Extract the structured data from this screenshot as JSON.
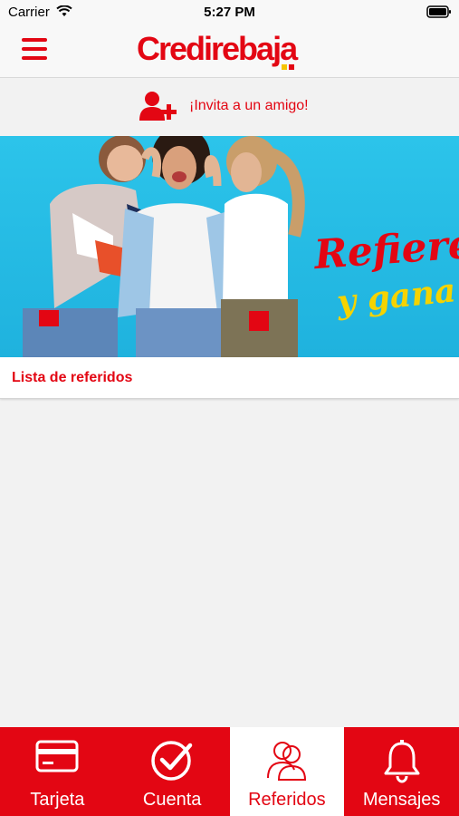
{
  "status_bar": {
    "carrier": "Carrier",
    "time": "5:27 PM"
  },
  "header": {
    "logo": "Credirebaja"
  },
  "invite": {
    "label": "¡Invita a un amigo!"
  },
  "banner": {
    "title": "Refiere",
    "subtitle": "y gana"
  },
  "list": {
    "title": "Lista de referidos"
  },
  "colors": {
    "brand_red": "#e30613",
    "accent_yellow": "#f5c400",
    "banner_blue": "#2cc4ea"
  },
  "tabs": [
    {
      "label": "Tarjeta",
      "icon": "credit-card-icon",
      "active": false
    },
    {
      "label": "Cuenta",
      "icon": "check-circle-icon",
      "active": false
    },
    {
      "label": "Referidos",
      "icon": "users-icon",
      "active": true
    },
    {
      "label": "Mensajes",
      "icon": "bell-icon",
      "active": false
    }
  ]
}
